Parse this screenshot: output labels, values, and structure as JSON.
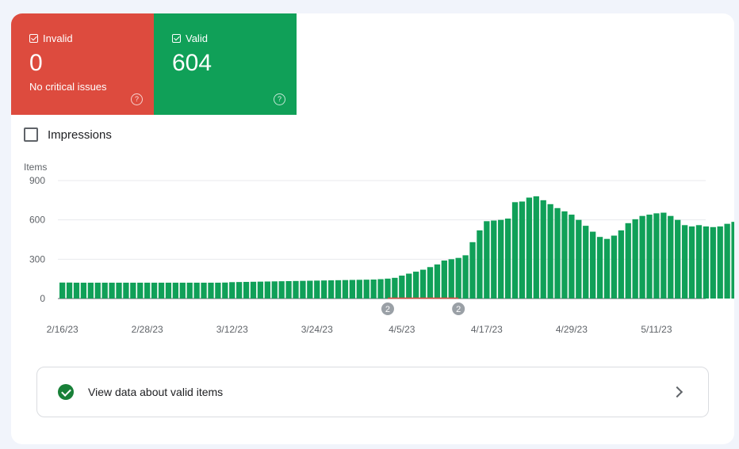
{
  "tiles": {
    "invalid": {
      "label": "Invalid",
      "value": "0",
      "sub": "No critical issues",
      "color": "#dd4b3e"
    },
    "valid": {
      "label": "Valid",
      "value": "604",
      "color": "#10a058"
    }
  },
  "impressions_label": "Impressions",
  "view_link": {
    "label": "View data about valid items"
  },
  "chart_data": {
    "type": "bar",
    "ylabel": "Items",
    "ylim": [
      0,
      900
    ],
    "yticks": [
      0,
      300,
      600,
      900
    ],
    "grid": true,
    "bar_color": "#10a058",
    "start_date": "2/16/23",
    "x_tick_labels": [
      "2/16/23",
      "2/28/23",
      "3/12/23",
      "3/24/23",
      "4/5/23",
      "4/17/23",
      "4/29/23",
      "5/11/23"
    ],
    "annotations": [
      {
        "label": "2",
        "date": "4/3/23"
      },
      {
        "label": "2",
        "date": "4/13/23"
      }
    ],
    "values": [
      122,
      122,
      121,
      121,
      121,
      121,
      121,
      121,
      121,
      121,
      121,
      121,
      121,
      121,
      121,
      121,
      121,
      121,
      121,
      121,
      121,
      121,
      121,
      122,
      125,
      126,
      127,
      128,
      129,
      130,
      131,
      132,
      133,
      134,
      135,
      136,
      137,
      138,
      139,
      140,
      141,
      142,
      143,
      144,
      145,
      148,
      152,
      158,
      175,
      190,
      205,
      220,
      240,
      260,
      290,
      300,
      310,
      330,
      430,
      520,
      590,
      595,
      600,
      610,
      735,
      740,
      770,
      780,
      750,
      720,
      690,
      665,
      640,
      600,
      555,
      510,
      470,
      455,
      480,
      520,
      575,
      605,
      630,
      640,
      650,
      655,
      630,
      600,
      560,
      550,
      560,
      550,
      545,
      550,
      570,
      585,
      600,
      604
    ]
  }
}
